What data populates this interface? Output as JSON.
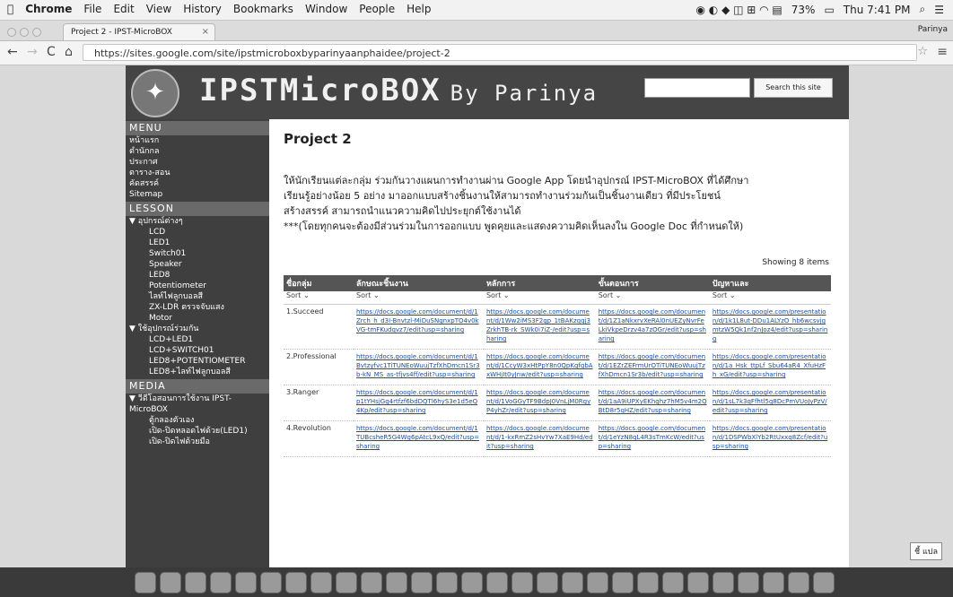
{
  "menubar": {
    "apple": "",
    "app": "Chrome",
    "items": [
      "File",
      "Edit",
      "View",
      "History",
      "Bookmarks",
      "Window",
      "People",
      "Help"
    ],
    "battery": "73%",
    "clock": "Thu 7:41 PM"
  },
  "tab": {
    "title": "Project 2 - IPST-MicroBOX"
  },
  "profile": "Parinya",
  "address": {
    "url": "https://sites.google.com/site/ipstmicroboxbyparinyaanphaidee/project-2"
  },
  "banner": {
    "title": "IPSTMicroBOX",
    "by": "By Parinya",
    "search_label": "Search this site"
  },
  "sidebar": {
    "menu_head": "MENU",
    "menu_items": [
      "หน้าแรก",
      "ตำนักกล",
      "ประกาศ",
      "ตาราง-สอน",
      "คัดสรรค์",
      "Sitemap"
    ],
    "lesson_head": "LESSON",
    "group1": "▼ อุปกรณ์ต่างๆ",
    "group1_items": [
      "LCD",
      "LED1",
      "Switch01",
      "Speaker",
      "LED8",
      "Potentiometer",
      "ไลท์ไฟลูกบอลสี",
      "ZX-LDR ตรวจจับแสง",
      "Motor"
    ],
    "group2": "▼ ใช้อุปกรณ์ร่วมกัน",
    "group2_items": [
      "LCD+LED1",
      "LCD+SWITCH01",
      "LED8+POTENTIOMETER",
      "LED8+ไลท์ไฟลูกบอลสี"
    ],
    "media_head": "MEDIA",
    "group3": "▼ วีดีโอสอนการใช้งาน IPST-MicroBOX",
    "group3_items": [
      "ตู้กลองตัวเอง",
      "เปิด-ปิดหลอดไฟด้วย(LED1)",
      "เปิด-ปิดไฟด้วยมือ"
    ]
  },
  "main": {
    "title": "Project 2",
    "desc": [
      "ให้นักเรียนแต่ละกลุ่ม ร่วมกันวางแผนการทำงานผ่าน Google App โดยนำอุปกรณ์ IPST-MicroBOX ที่ได้ศึกษา",
      "เรียนรู้อย่างน้อย 5 อย่าง มาออกแบบสร้างชิ้นงานให้สามารถทำงานร่วมกันเป็นชิ้นงานเดียว ที่มีประโยชน์",
      "สร้างสรรค์ สามารถนำแนวความคิดไปประยุกต์ใช้งานได้",
      "***(โดยทุกคนจะต้องมีส่วนร่วมในการออกแบบ พูดคุยและแสดงความคิดเห็นลงใน Google Doc ที่กำหนดให้)"
    ],
    "showing": "Showing 8 items",
    "columns": [
      "ชื่อกลุ่ม",
      "ลักษณะชิ้นงาน",
      "หลักการ",
      "ขั้นตอนการ",
      "ปัญหาและ"
    ],
    "sort_label": "Sort",
    "rows": [
      {
        "name": "1.Succeed",
        "links": [
          "https://docs.google.com/document/d/1Zrch_h_d3I-Bnvtzl-MiDuSNgnxpTO4v0kVG-tmFKudqvz7/edit?usp=sharing",
          "https://docs.google.com/document/d/1Ww2iMS3F2gp_1tBAKzqqj3ZrkhTB-rk_SWk0i7iZ-/edit?usp=sharing",
          "https://docs.google.com/document/d/1Z1aNkxrvXeRAl0nUEZyNvrFeLkiVkpeDrzv4a7zOGr/edit?usp=sharing",
          "https://docs.google.com/presentation/d/1k1L8ut-DDu1ALYzO_hb6wcsvjgmtzW5Qk1nf2nJoz4/edit?usp=sharing"
        ]
      },
      {
        "name": "2.Professional",
        "links": [
          "https://docs.google.com/document/d/1Bvtzyfvc1TiTUNEoWuujTzfXhDmcn1Sr3b-kN_MS_as-tfjvs4ff/edit?usp=sharing",
          "https://docs.google.com/document/d/1CcyW3xHtPpY8n0QpKgfgbAxWHjIt0yJnw/edit?usp=sharing",
          "https://docs.google.com/document/d/1EZrZEFrmUrOTiTUNEoWuujTzfXhDmcn1Sr3b/edit?usp=sharing",
          "https://docs.google.com/presentation/d/1a_Hsk_ttpLf_Sbu64aR4_XfuHzFh_xG/edit?usp=sharing"
        ]
      },
      {
        "name": "3.Ranger",
        "links": [
          "https://docs.google.com/document/d/1p1tYHsjGg4rtfzf6bdDQTl6hyS3e1d5eQ4Kp/edit?usp=sharing",
          "https://docs.google.com/document/d/1VoGGyTF9BdpJ0VnLjM0RgyP4yhZr/edit?usp=sharing",
          "https://docs.google.com/document/d/1aA9iUPXyEKhghz7hM5v4m2QBtD8r5qHZ/edit?usp=sharing",
          "https://docs.google.com/presentation/d/1sL7k3qFfhtl5g8DcPmVUoJyPzV/edit?usp=sharing"
        ]
      },
      {
        "name": "4.Revolution",
        "links": [
          "https://docs.google.com/document/d/1TUBcsheR5G4Wg6pAtcL9xQ/edit?usp=sharing",
          "https://docs.google.com/document/d/1-kxRmZ2sHvYw7XaE9Hd/edit?usp=sharing",
          "https://docs.google.com/document/d/1eYzN8qL4R3sTmKcW/edit?usp=sharing",
          "https://docs.google.com/presentation/d/1DSPWbXlYb2RtUxxq8Zcf/edit?usp=sharing"
        ]
      }
    ]
  },
  "badge": "ชี้ แปล"
}
